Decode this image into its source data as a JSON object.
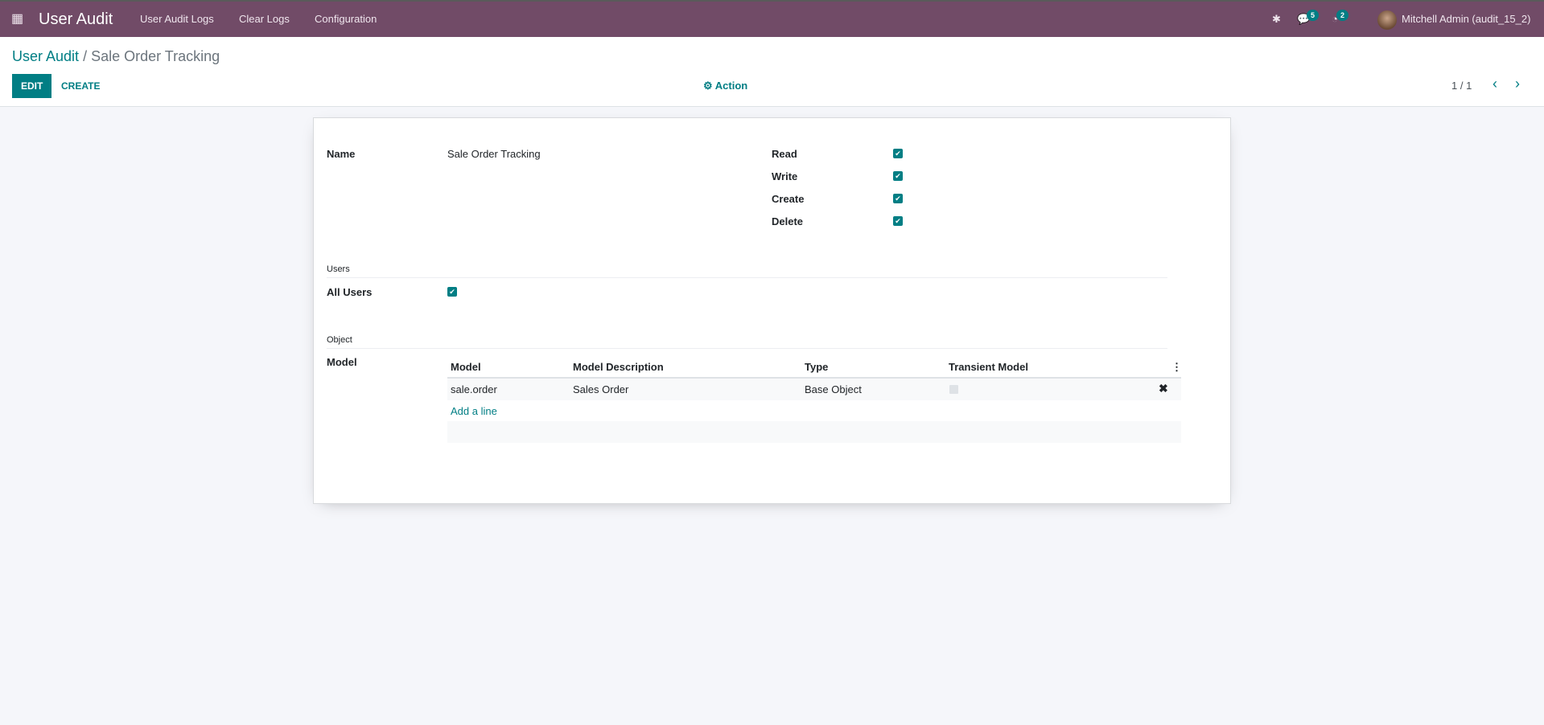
{
  "navbar": {
    "app_name": "User Audit",
    "menu": [
      "User Audit Logs",
      "Clear Logs",
      "Configuration"
    ],
    "messages_count": "5",
    "activities_count": "2",
    "user": "Mitchell Admin (audit_15_2)",
    "color": "#714B67"
  },
  "breadcrumb": {
    "parent": "User Audit",
    "separator": "/",
    "current": "Sale Order Tracking"
  },
  "toolbar": {
    "edit": "EDIT",
    "create": "CREATE",
    "action": "Action",
    "pager": "1 / 1"
  },
  "form": {
    "name_label": "Name",
    "name_value": "Sale Order Tracking",
    "perms": [
      {
        "label": "Read",
        "checked": true
      },
      {
        "label": "Write",
        "checked": true
      },
      {
        "label": "Create",
        "checked": true
      },
      {
        "label": "Delete",
        "checked": true
      }
    ],
    "users_section": "Users",
    "all_users_label": "All Users",
    "all_users": true,
    "object_section": "Object",
    "model_label": "Model",
    "table": {
      "headers": [
        "Model",
        "Model Description",
        "Type",
        "Transient Model"
      ],
      "rows": [
        {
          "model": "sale.order",
          "description": "Sales Order",
          "type": "Base Object",
          "transient": false
        }
      ],
      "add_line": "Add a line"
    }
  }
}
